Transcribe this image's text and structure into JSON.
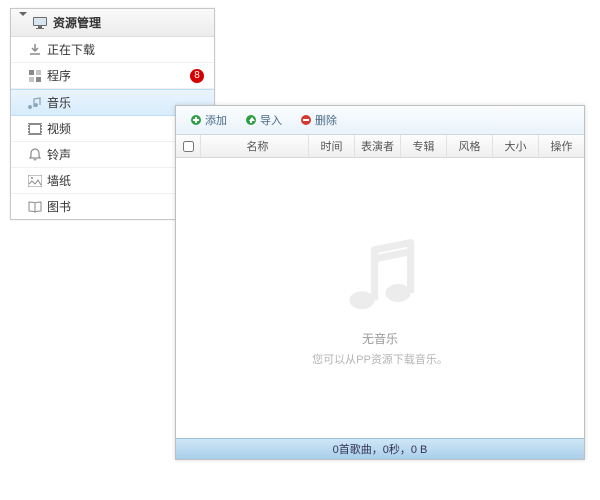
{
  "sidebar": {
    "title": "资源管理",
    "items": [
      {
        "label": "正在下载",
        "icon": "download-icon"
      },
      {
        "label": "程序",
        "icon": "apps-icon",
        "badge": "8"
      },
      {
        "label": "音乐",
        "icon": "music-icon",
        "selected": true
      },
      {
        "label": "视频",
        "icon": "video-icon"
      },
      {
        "label": "铃声",
        "icon": "ringtone-icon"
      },
      {
        "label": "墙纸",
        "icon": "wallpaper-icon"
      },
      {
        "label": "图书",
        "icon": "book-icon"
      }
    ]
  },
  "toolbar": {
    "add": "添加",
    "import": "导入",
    "delete": "删除"
  },
  "columns": {
    "name": "名称",
    "time": "时间",
    "artist": "表演者",
    "album": "专辑",
    "genre": "风格",
    "size": "大小",
    "action": "操作"
  },
  "empty": {
    "title": "无音乐",
    "subtitle": "您可以从PP资源下载音乐。"
  },
  "status": "0首歌曲，0秒，0 B"
}
